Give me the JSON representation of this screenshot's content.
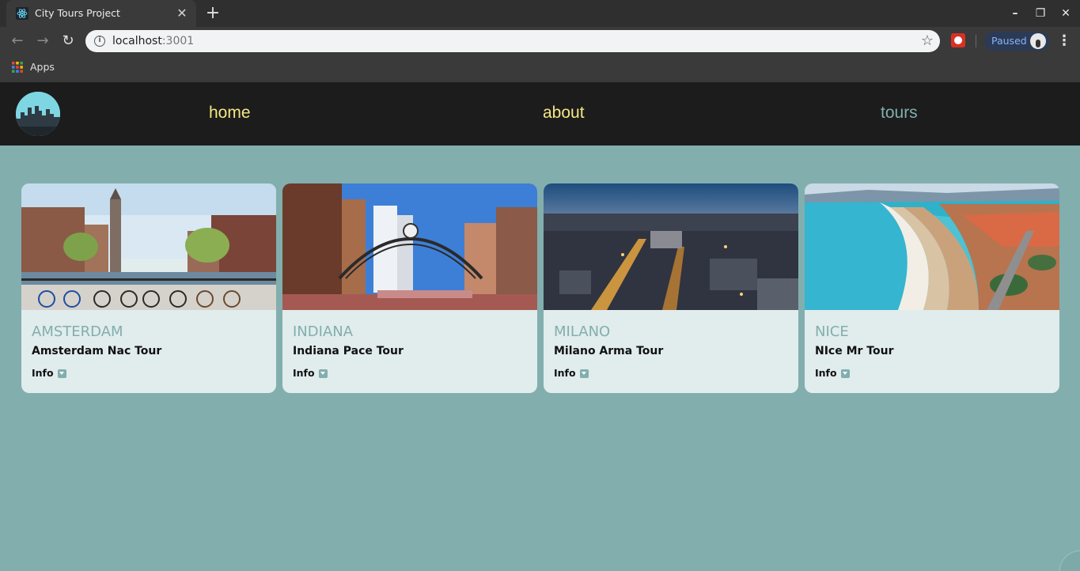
{
  "browser": {
    "tab_title": "City Tours Project",
    "url_host": "localhost",
    "url_port": ":3001",
    "profile_status": "Paused",
    "bookmarks": [
      {
        "label": "Apps"
      }
    ]
  },
  "navbar": {
    "links": [
      {
        "label": "home"
      },
      {
        "label": "about"
      },
      {
        "label": "tours"
      }
    ]
  },
  "tours": [
    {
      "city": "AMSTERDAM",
      "name": "Amsterdam Nac Tour",
      "info_label": "Info"
    },
    {
      "city": "INDIANA",
      "name": "Indiana Pace Tour",
      "info_label": "Info"
    },
    {
      "city": "MILANO",
      "name": "Milano Arma Tour",
      "info_label": "Info"
    },
    {
      "city": "NICE",
      "name": "NIce Mr Tour",
      "info_label": "Info"
    }
  ],
  "colors": {
    "page_background": "#82aeae",
    "navbar_background": "#1c1c1c",
    "nav_link": "#f4e784",
    "nav_link_active": "#82aeae",
    "card_background": "#e1ecec",
    "city_text": "#82aeae"
  }
}
